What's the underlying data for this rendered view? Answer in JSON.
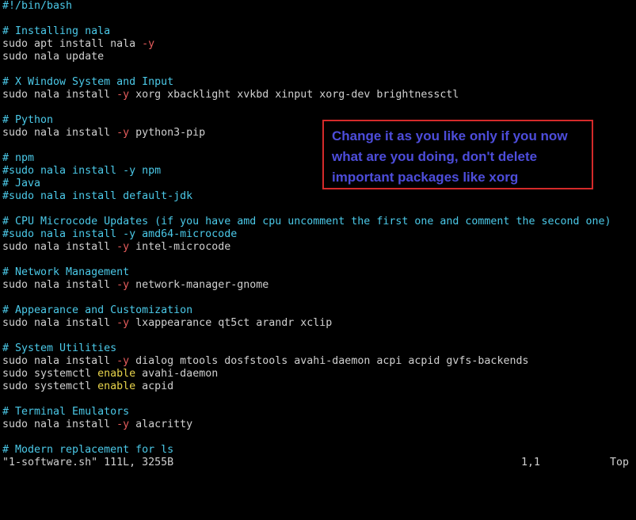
{
  "colors": {
    "background": "#000000",
    "text": "#d0d0d0",
    "comment": "#4bc9e8",
    "flag": "#e65c5c",
    "keyword": "#e8d44b",
    "callout_text": "#4d4ddb",
    "callout_border": "#d42a2a"
  },
  "editor": {
    "lines": [
      [
        {
          "t": "#!/bin/bash",
          "c": "comment"
        }
      ],
      [],
      [
        {
          "t": "# Installing nala",
          "c": "comment"
        }
      ],
      [
        {
          "t": "sudo apt install nala ",
          "c": "text"
        },
        {
          "t": "-y",
          "c": "flag"
        }
      ],
      [
        {
          "t": "sudo nala update",
          "c": "text"
        }
      ],
      [],
      [
        {
          "t": "# X Window System and Input",
          "c": "comment"
        }
      ],
      [
        {
          "t": "sudo nala install ",
          "c": "text"
        },
        {
          "t": "-y",
          "c": "flag"
        },
        {
          "t": " xorg xbacklight xvkbd xinput xorg-dev brightnessctl",
          "c": "text"
        }
      ],
      [],
      [
        {
          "t": "# Python",
          "c": "comment"
        }
      ],
      [
        {
          "t": "sudo nala install ",
          "c": "text"
        },
        {
          "t": "-y",
          "c": "flag"
        },
        {
          "t": " python3-pip",
          "c": "text"
        }
      ],
      [],
      [
        {
          "t": "# npm",
          "c": "comment"
        }
      ],
      [
        {
          "t": "#sudo nala install -y npm",
          "c": "comment"
        }
      ],
      [
        {
          "t": "# Java",
          "c": "comment"
        }
      ],
      [
        {
          "t": "#sudo nala install default-jdk",
          "c": "comment"
        }
      ],
      [],
      [
        {
          "t": "# CPU Microcode Updates (if you have amd cpu uncomment the first one and comment the second one)",
          "c": "comment"
        }
      ],
      [
        {
          "t": "#sudo nala install -y amd64-microcode",
          "c": "comment"
        }
      ],
      [
        {
          "t": "sudo nala install ",
          "c": "text"
        },
        {
          "t": "-y",
          "c": "flag"
        },
        {
          "t": " intel-microcode",
          "c": "text"
        }
      ],
      [],
      [
        {
          "t": "# Network Management",
          "c": "comment"
        }
      ],
      [
        {
          "t": "sudo nala install ",
          "c": "text"
        },
        {
          "t": "-y",
          "c": "flag"
        },
        {
          "t": " network-manager-gnome",
          "c": "text"
        }
      ],
      [],
      [
        {
          "t": "# Appearance and Customization",
          "c": "comment"
        }
      ],
      [
        {
          "t": "sudo nala install ",
          "c": "text"
        },
        {
          "t": "-y",
          "c": "flag"
        },
        {
          "t": " lxappearance qt5ct arandr xclip",
          "c": "text"
        }
      ],
      [],
      [
        {
          "t": "# System Utilities",
          "c": "comment"
        }
      ],
      [
        {
          "t": "sudo nala install ",
          "c": "text"
        },
        {
          "t": "-y",
          "c": "flag"
        },
        {
          "t": " dialog mtools dosfstools avahi-daemon acpi acpid gvfs-backends",
          "c": "text"
        }
      ],
      [
        {
          "t": "sudo systemctl ",
          "c": "text"
        },
        {
          "t": "enable",
          "c": "keyword"
        },
        {
          "t": " avahi-daemon",
          "c": "text"
        }
      ],
      [
        {
          "t": "sudo systemctl ",
          "c": "text"
        },
        {
          "t": "enable",
          "c": "keyword"
        },
        {
          "t": " acpid",
          "c": "text"
        }
      ],
      [],
      [
        {
          "t": "# Terminal Emulators",
          "c": "comment"
        }
      ],
      [
        {
          "t": "sudo nala install ",
          "c": "text"
        },
        {
          "t": "-y",
          "c": "flag"
        },
        {
          "t": " alacritty",
          "c": "text"
        }
      ],
      [],
      [
        {
          "t": "# Modern replacement for ls",
          "c": "comment"
        }
      ]
    ]
  },
  "status": {
    "file": "\"1-software.sh\" 111L, 3255B",
    "position": "1,1",
    "scroll": "Top"
  },
  "callout": {
    "text": "Change it as you like only if you now what are you doing, don't delete important packages like xorg"
  }
}
